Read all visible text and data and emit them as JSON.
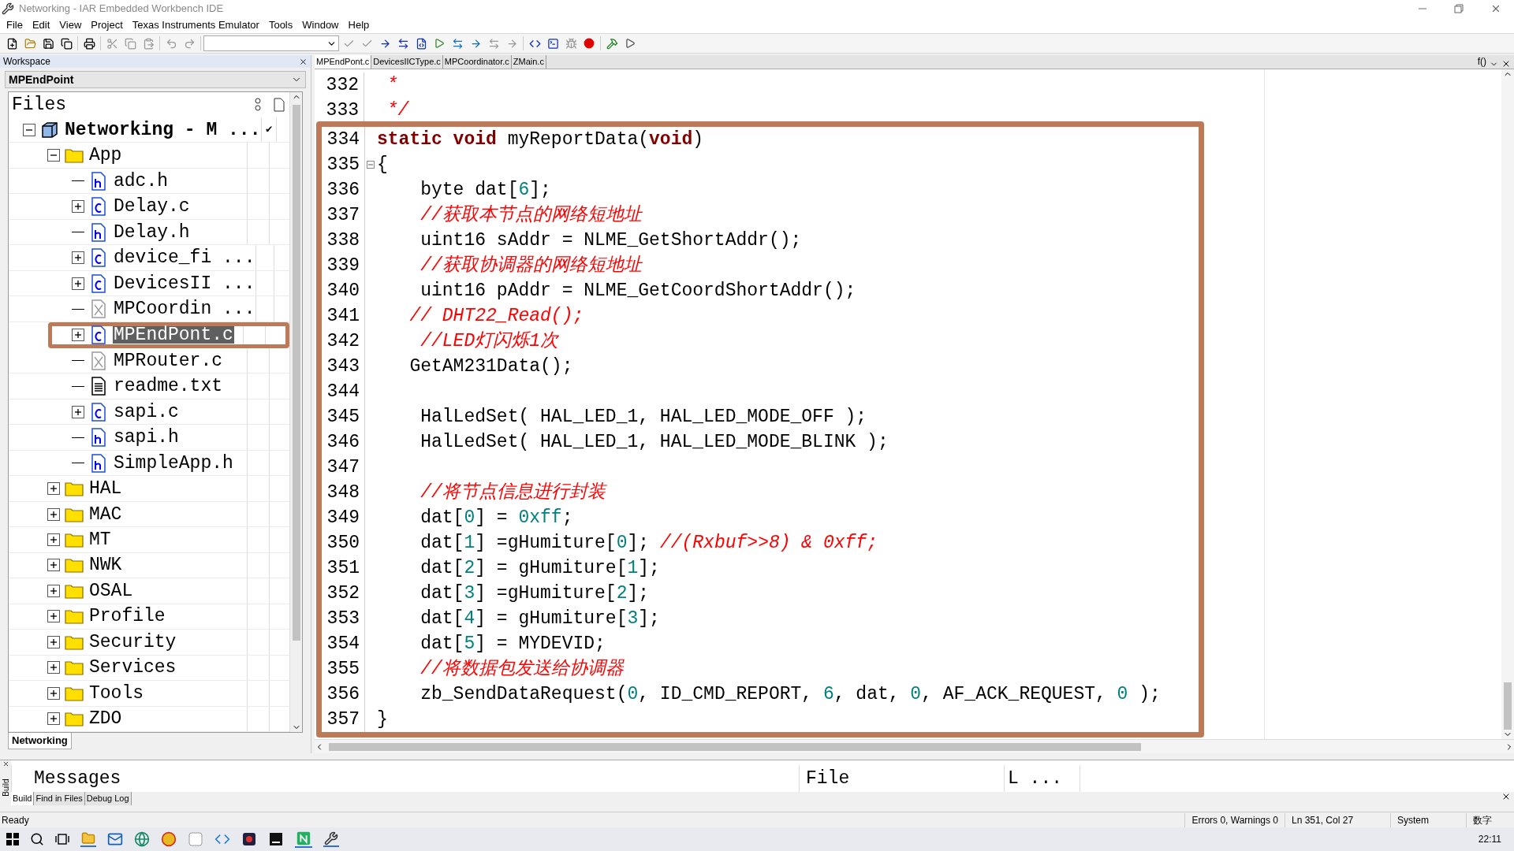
{
  "window": {
    "title": "Networking - IAR Embedded Workbench IDE"
  },
  "menu": [
    "File",
    "Edit",
    "View",
    "Project",
    "Texas Instruments Emulator",
    "Tools",
    "Window",
    "Help"
  ],
  "workspace": {
    "title": "Workspace",
    "configuration": "MPEndPoint",
    "column_header": "Files",
    "tab": "Networking",
    "tree": [
      {
        "label": "Networking - M ...",
        "kind": "project",
        "expanded": true,
        "selected": false,
        "check": "✔",
        "children": [
          {
            "label": "App",
            "kind": "folder",
            "expanded": true,
            "selected": false,
            "children": [
              {
                "label": "adc.h",
                "kind": "h",
                "selected": false
              },
              {
                "label": "Delay.c",
                "kind": "c",
                "expanded": false,
                "selected": false
              },
              {
                "label": "Delay.h",
                "kind": "h",
                "selected": false
              },
              {
                "label": "device_fi ...",
                "kind": "c",
                "expanded": false,
                "selected": false
              },
              {
                "label": "DevicesII ...",
                "kind": "c",
                "expanded": false,
                "selected": false
              },
              {
                "label": "MPCoordin ...",
                "kind": "excluded",
                "selected": false
              },
              {
                "label": "MPEndPont.c",
                "kind": "c",
                "expanded": false,
                "selected": true,
                "annotated": true
              },
              {
                "label": "MPRouter.c",
                "kind": "excluded",
                "selected": false
              },
              {
                "label": "readme.txt",
                "kind": "txt",
                "selected": false
              },
              {
                "label": "sapi.c",
                "kind": "c",
                "expanded": false,
                "selected": false
              },
              {
                "label": "sapi.h",
                "kind": "h",
                "selected": false
              },
              {
                "label": "SimpleApp.h",
                "kind": "h",
                "selected": false
              }
            ]
          },
          {
            "label": "HAL",
            "kind": "folder",
            "expanded": false,
            "selected": false
          },
          {
            "label": "MAC",
            "kind": "folder",
            "expanded": false,
            "selected": false
          },
          {
            "label": "MT",
            "kind": "folder",
            "expanded": false,
            "selected": false
          },
          {
            "label": "NWK",
            "kind": "folder",
            "expanded": false,
            "selected": false
          },
          {
            "label": "OSAL",
            "kind": "folder",
            "expanded": false,
            "selected": false
          },
          {
            "label": "Profile",
            "kind": "folder",
            "expanded": false,
            "selected": false
          },
          {
            "label": "Security",
            "kind": "folder",
            "expanded": false,
            "selected": false
          },
          {
            "label": "Services",
            "kind": "folder",
            "expanded": false,
            "selected": false
          },
          {
            "label": "Tools",
            "kind": "folder",
            "expanded": false,
            "selected": false
          },
          {
            "label": "ZDO",
            "kind": "folder",
            "expanded": false,
            "selected": false
          }
        ]
      }
    ]
  },
  "editor": {
    "tabs": [
      {
        "label": "MPEndPont.c",
        "selected": true
      },
      {
        "label": "DevicesIICType.c",
        "selected": false
      },
      {
        "label": "MPCoordinator.c",
        "selected": false
      },
      {
        "label": "ZMain.c",
        "selected": false
      }
    ],
    "function_button": "f()",
    "lines": [
      {
        "number": "332",
        "tokens": [
          {
            "kind": "comment",
            "text": " *"
          }
        ]
      },
      {
        "number": "333",
        "tokens": [
          {
            "kind": "comment",
            "text": " */"
          }
        ]
      }
    ],
    "highlighted_lines": [
      {
        "number": "334",
        "tokens": [
          {
            "kind": "keyword",
            "text": "static void"
          },
          {
            "kind": "plain",
            "text": " myReportData("
          },
          {
            "kind": "keyword",
            "text": "void"
          },
          {
            "kind": "plain",
            "text": ")"
          }
        ]
      },
      {
        "number": "335",
        "fold": true,
        "tokens": [
          {
            "kind": "plain",
            "text": "{"
          }
        ]
      },
      {
        "number": "336",
        "tokens": [
          {
            "kind": "plain",
            "text": "    byte dat["
          },
          {
            "kind": "number",
            "text": "6"
          },
          {
            "kind": "plain",
            "text": "];"
          }
        ]
      },
      {
        "number": "337",
        "tokens": [
          {
            "kind": "comment",
            "text": "    //获取本节点的网络短地址"
          }
        ]
      },
      {
        "number": "338",
        "tokens": [
          {
            "kind": "plain",
            "text": "    uint16 sAddr = NLME_GetShortAddr();"
          }
        ]
      },
      {
        "number": "339",
        "tokens": [
          {
            "kind": "comment",
            "text": "    //获取协调器的网络短地址"
          }
        ]
      },
      {
        "number": "340",
        "tokens": [
          {
            "kind": "plain",
            "text": "    uint16 pAddr = NLME_GetCoordShortAddr();"
          }
        ]
      },
      {
        "number": "341",
        "tokens": [
          {
            "kind": "comment",
            "text": "   // DHT22_Read();"
          }
        ]
      },
      {
        "number": "342",
        "tokens": [
          {
            "kind": "comment",
            "text": "    //LED灯闪烁1次"
          }
        ]
      },
      {
        "number": "343",
        "tokens": [
          {
            "kind": "plain",
            "text": "   GetAM231Data();"
          }
        ]
      },
      {
        "number": "344"
      },
      {
        "number": "345",
        "tokens": [
          {
            "kind": "plain",
            "text": "    HalLedSet( HAL_LED_1, HAL_LED_MODE_OFF );"
          }
        ]
      },
      {
        "number": "346",
        "tokens": [
          {
            "kind": "plain",
            "text": "    HalLedSet( HAL_LED_1, HAL_LED_MODE_BLINK );"
          }
        ]
      },
      {
        "number": "347"
      },
      {
        "number": "348",
        "tokens": [
          {
            "kind": "comment",
            "text": "    //将节点信息进行封装"
          }
        ]
      },
      {
        "number": "349",
        "tokens": [
          {
            "kind": "plain",
            "text": "    dat["
          },
          {
            "kind": "number",
            "text": "0"
          },
          {
            "kind": "plain",
            "text": "] = "
          },
          {
            "kind": "number",
            "text": "0xff"
          },
          {
            "kind": "plain",
            "text": ";"
          }
        ]
      },
      {
        "number": "350",
        "tokens": [
          {
            "kind": "plain",
            "text": "    dat["
          },
          {
            "kind": "number",
            "text": "1"
          },
          {
            "kind": "plain",
            "text": "] =gHumiture["
          },
          {
            "kind": "number",
            "text": "0"
          },
          {
            "kind": "plain",
            "text": "]; "
          },
          {
            "kind": "comment",
            "text": "//(Rxbuf>>8) & 0xff;"
          }
        ]
      },
      {
        "number": "351",
        "tokens": [
          {
            "kind": "plain",
            "text": "    dat["
          },
          {
            "kind": "number",
            "text": "2"
          },
          {
            "kind": "plain",
            "text": "] = gHumiture["
          },
          {
            "kind": "number",
            "text": "1"
          },
          {
            "kind": "plain",
            "text": "];"
          }
        ]
      },
      {
        "number": "352",
        "tokens": [
          {
            "kind": "plain",
            "text": "    dat["
          },
          {
            "kind": "number",
            "text": "3"
          },
          {
            "kind": "plain",
            "text": "] =gHumiture["
          },
          {
            "kind": "number",
            "text": "2"
          },
          {
            "kind": "plain",
            "text": "];"
          }
        ]
      },
      {
        "number": "353",
        "tokens": [
          {
            "kind": "plain",
            "text": "    dat["
          },
          {
            "kind": "number",
            "text": "4"
          },
          {
            "kind": "plain",
            "text": "] = gHumiture["
          },
          {
            "kind": "number",
            "text": "3"
          },
          {
            "kind": "plain",
            "text": "];"
          }
        ]
      },
      {
        "number": "354",
        "tokens": [
          {
            "kind": "plain",
            "text": "    dat["
          },
          {
            "kind": "number",
            "text": "5"
          },
          {
            "kind": "plain",
            "text": "] = MYDEVID;"
          }
        ]
      },
      {
        "number": "355",
        "tokens": [
          {
            "kind": "comment",
            "text": "    //将数据包发送给协调器"
          }
        ]
      },
      {
        "number": "356",
        "tokens": [
          {
            "kind": "plain",
            "text": "    zb_SendDataRequest("
          },
          {
            "kind": "number",
            "text": "0"
          },
          {
            "kind": "plain",
            "text": ", ID_CMD_REPORT, "
          },
          {
            "kind": "number",
            "text": "6"
          },
          {
            "kind": "plain",
            "text": ", dat, "
          },
          {
            "kind": "number",
            "text": "0"
          },
          {
            "kind": "plain",
            "text": ", AF_ACK_REQUEST, "
          },
          {
            "kind": "number",
            "text": "0"
          },
          {
            "kind": "plain",
            "text": " );"
          }
        ]
      },
      {
        "number": "357",
        "tokens": [
          {
            "kind": "plain",
            "text": "}"
          }
        ]
      }
    ]
  },
  "messages": {
    "columns": [
      "Messages",
      "File",
      "L ..."
    ],
    "side_label": "Build",
    "tabs": [
      {
        "label": "Build",
        "selected": true
      },
      {
        "label": "Find in Files",
        "selected": false
      },
      {
        "label": "Debug Log",
        "selected": false
      }
    ]
  },
  "status_bar": {
    "message": "Ready",
    "fields": [
      "Errors 0, Warnings 0",
      "Ln 351, Col 27",
      "System",
      "数字"
    ]
  },
  "taskbar": {
    "time": "22:11"
  }
}
